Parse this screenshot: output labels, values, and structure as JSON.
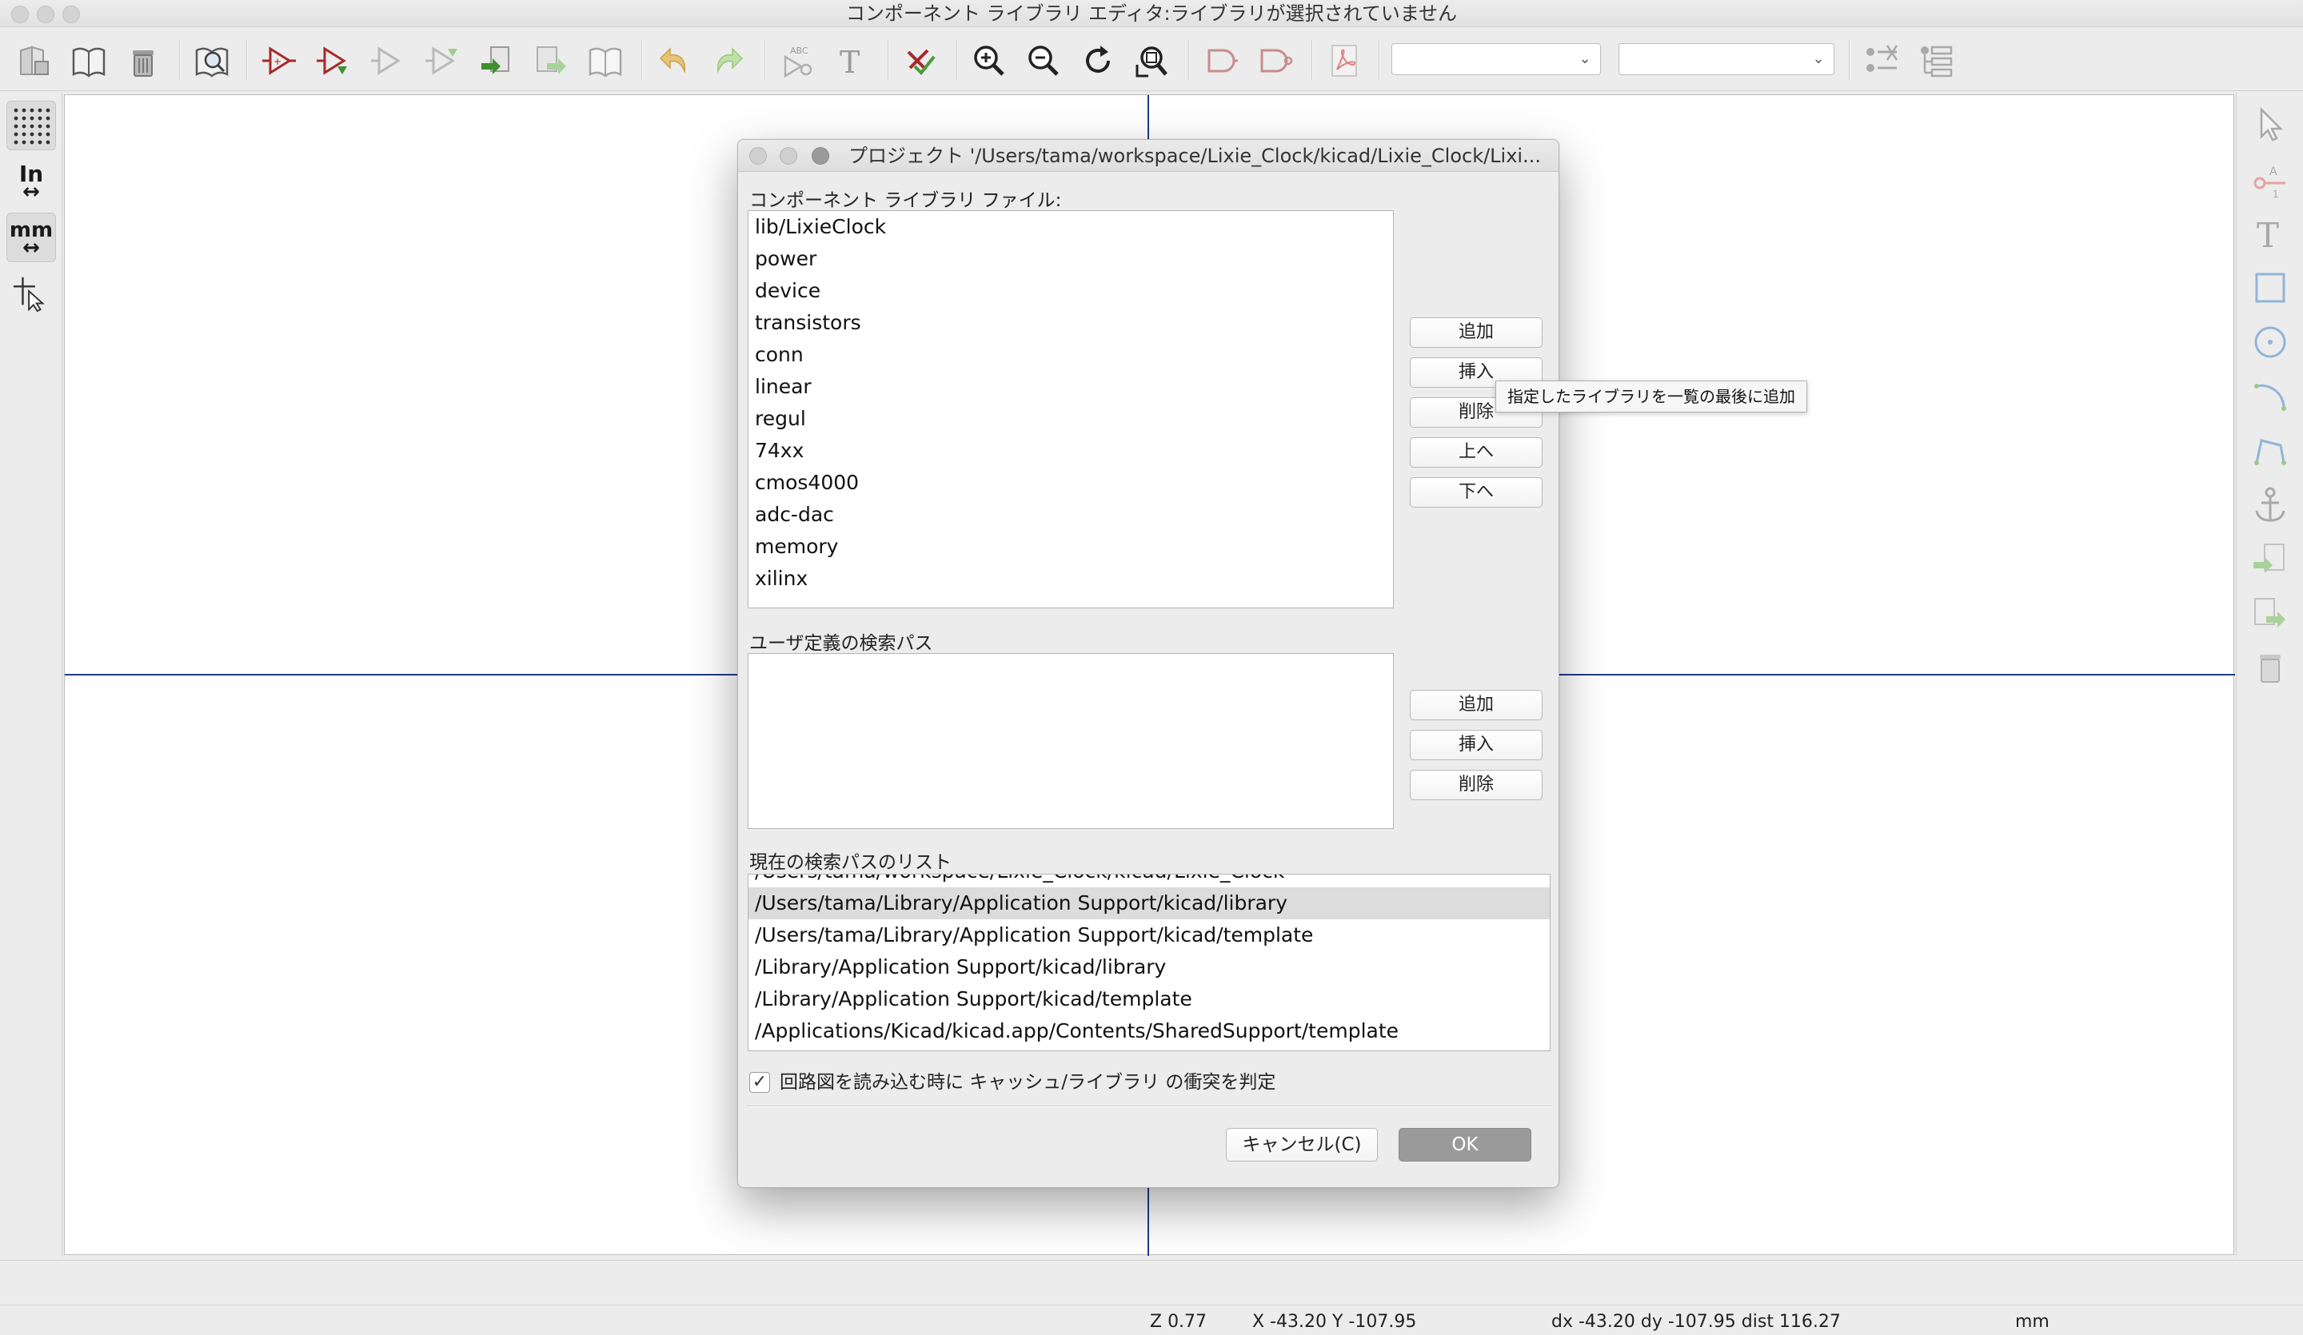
{
  "window": {
    "title": "コンポーネント ライブラリ エディタ:ライブラリが選択されていません"
  },
  "toolbar": {
    "icons": [
      "save-library-icon",
      "select-library-icon",
      "delete-library-icon",
      "library-browser-icon",
      "new-component-icon",
      "load-component-icon",
      "save-component-icon",
      "create-from-current-icon",
      "import-component-icon",
      "export-component-icon",
      "save-as-library-icon",
      "undo-icon",
      "redo-icon",
      "component-properties-icon",
      "text-field-icon",
      "check-pins-icon",
      "zoom-in-icon",
      "zoom-out-icon",
      "redraw-icon",
      "zoom-fit-icon",
      "normal-body-icon",
      "demorgan-body-icon",
      "pdf-datasheet-icon",
      "pin-table-icon",
      "search-settings-icon"
    ],
    "unit_select": {
      "value": ""
    },
    "alias_select": {
      "value": ""
    }
  },
  "left_toolbar": {
    "inch_label": "In",
    "mm_label": "mm"
  },
  "dialog": {
    "title": "プロジェクト '/Users/tama/workspace/Lixie_Clock/kicad/Lixie_Clock/Lixi...",
    "lib_files_label": "コンポーネント ライブラリ ファイル:",
    "lib_files": [
      "lib/LixieClock",
      "power",
      "device",
      "transistors",
      "conn",
      "linear",
      "regul",
      "74xx",
      "cmos4000",
      "adc-dac",
      "memory",
      "xilinx"
    ],
    "lib_buttons": {
      "add": "追加",
      "insert": "挿入",
      "remove": "削除",
      "up": "上へ",
      "down": "下へ"
    },
    "user_paths_label": "ユーザ定義の検索パス",
    "user_paths": [],
    "path_buttons": {
      "add": "追加",
      "insert": "挿入",
      "remove": "削除"
    },
    "current_paths_label": "現在の検索パスのリスト",
    "current_paths_cut": "/Users/tama/workspace/Lixie_Clock/kicad/Lixie_Clock",
    "current_paths": [
      "/Users/tama/Library/Application Support/kicad/library",
      "/Users/tama/Library/Application Support/kicad/template",
      "/Library/Application Support/kicad/library",
      "/Library/Application Support/kicad/template",
      "/Applications/Kicad/kicad.app/Contents/SharedSupport/template"
    ],
    "selected_path_index": 0,
    "check_conflicts_label": "回路図を読み込む時に キャッシュ/ライブラリ の衝突を判定",
    "check_conflicts_checked": true,
    "cancel_label": "キャンセル(C)",
    "ok_label": "OK"
  },
  "tooltip": {
    "text": "指定したライブラリを一覧の最後に追加"
  },
  "status": {
    "zoom": "Z 0.77",
    "xy": "X -43.20  Y -107.95",
    "delta": "dx -43.20  dy -107.95  dist 116.27",
    "units": "mm"
  },
  "colors": {
    "axis": "#1f3c88",
    "canvas": "#ffffff",
    "component_red": "#a52a2a"
  }
}
